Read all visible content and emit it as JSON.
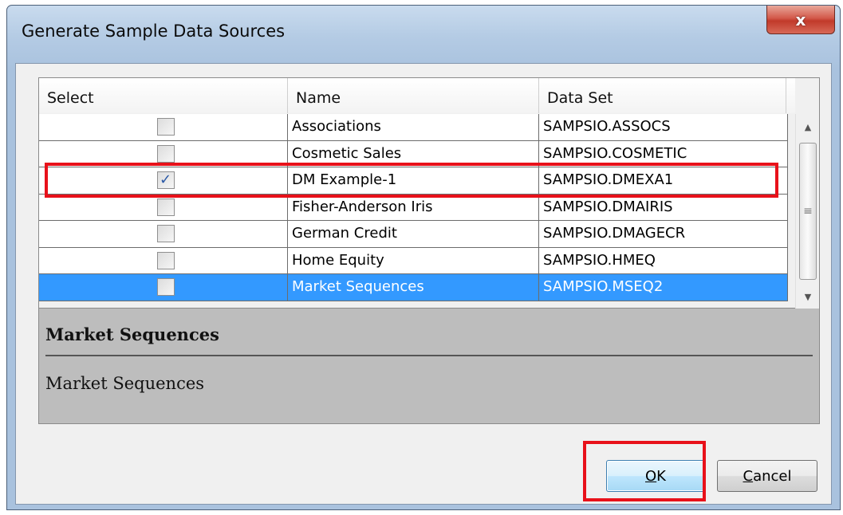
{
  "window": {
    "title": "Generate Sample Data Sources",
    "close_glyph": "x"
  },
  "grid": {
    "columns": [
      "Select",
      "Name",
      "Data Set"
    ],
    "rows": [
      {
        "checked": false,
        "name": "Associations",
        "dataset": "SAMPSIO.ASSOCS"
      },
      {
        "checked": false,
        "name": "Cosmetic Sales",
        "dataset": "SAMPSIO.COSMETIC"
      },
      {
        "checked": true,
        "name": "DM Example-1",
        "dataset": "SAMPSIO.DMEXA1"
      },
      {
        "checked": false,
        "name": "Fisher-Anderson Iris",
        "dataset": "SAMPSIO.DMAIRIS"
      },
      {
        "checked": false,
        "name": "German Credit",
        "dataset": "SAMPSIO.DMAGECR"
      },
      {
        "checked": false,
        "name": "Home Equity",
        "dataset": "SAMPSIO.HMEQ"
      },
      {
        "checked": false,
        "name": "Market Sequences",
        "dataset": "SAMPSIO.MSEQ2",
        "selected": true
      }
    ],
    "check_glyph": "✓"
  },
  "description": {
    "title": "Market Sequences",
    "body": "Market Sequences"
  },
  "buttons": {
    "ok_mnemonic": "O",
    "ok_rest": "K",
    "cancel_mnemonic": "C",
    "cancel_rest": "ancel"
  },
  "colors": {
    "selection": "#3399ff",
    "highlight": "#e8111a",
    "close_button": "#c13a2a"
  },
  "icons": {
    "scroll_up": "scroll-up-arrow-icon",
    "scroll_down": "scroll-down-arrow-icon",
    "scroll_grip": "scroll-grip-icon",
    "close": "close-icon",
    "checkbox_check": "checkmark-icon"
  }
}
